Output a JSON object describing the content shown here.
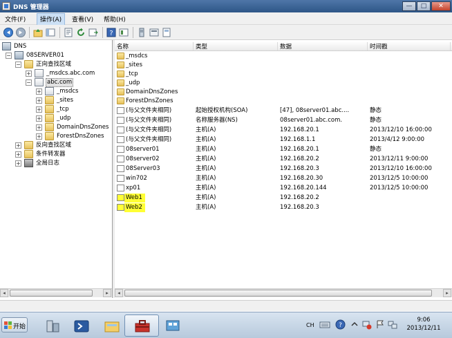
{
  "window": {
    "title": "DNS 管理器",
    "buttons": {
      "minimize": "—",
      "maximize": "□",
      "close": "✕"
    }
  },
  "menu": {
    "items": [
      {
        "label": "文件(F)"
      },
      {
        "label": "操作(A)"
      },
      {
        "label": "查看(V)"
      },
      {
        "label": "帮助(H)"
      }
    ]
  },
  "tree": {
    "root": {
      "label": "DNS"
    },
    "server": {
      "label": "08SERVER01"
    },
    "forward": {
      "label": "正向查找区域"
    },
    "msdcs_zone": {
      "label": "_msdcs.abc.com"
    },
    "abc_zone": {
      "label": "abc.com"
    },
    "children": [
      {
        "label": "_msdcs"
      },
      {
        "label": "_sites"
      },
      {
        "label": "_tcp"
      },
      {
        "label": "_udp"
      },
      {
        "label": "DomainDnsZones"
      },
      {
        "label": "ForestDnsZones"
      }
    ],
    "reverse": {
      "label": "反向查找区域"
    },
    "forwarders": {
      "label": "条件转发器"
    },
    "logs": {
      "label": "全局日志"
    }
  },
  "list": {
    "columns": {
      "name": "名称",
      "type": "类型",
      "data": "数据",
      "timestamp": "时间戳"
    },
    "folders": [
      {
        "name": "_msdcs"
      },
      {
        "name": "_sites"
      },
      {
        "name": "_tcp"
      },
      {
        "name": "_udp"
      },
      {
        "name": "DomainDnsZones"
      },
      {
        "name": "ForestDnsZones"
      }
    ],
    "records": [
      {
        "name": "(与父文件夹相同)",
        "type": "起始授权机构(SOA)",
        "data": "[47], 08server01.abc....",
        "timestamp": "静态",
        "highlight": false
      },
      {
        "name": "(与父文件夹相同)",
        "type": "名称服务器(NS)",
        "data": "08server01.abc.com.",
        "timestamp": "静态",
        "highlight": false
      },
      {
        "name": "(与父文件夹相同)",
        "type": "主机(A)",
        "data": "192.168.20.1",
        "timestamp": "2013/12/10 16:00:00",
        "highlight": false
      },
      {
        "name": "(与父文件夹相同)",
        "type": "主机(A)",
        "data": "192.168.1.1",
        "timestamp": "2013/4/12 9:00:00",
        "highlight": false
      },
      {
        "name": "08server01",
        "type": "主机(A)",
        "data": "192.168.20.1",
        "timestamp": "静态",
        "highlight": false
      },
      {
        "name": "08server02",
        "type": "主机(A)",
        "data": "192.168.20.2",
        "timestamp": "2013/12/11 9:00:00",
        "highlight": false
      },
      {
        "name": "08Server03",
        "type": "主机(A)",
        "data": "192.168.20.3",
        "timestamp": "2013/12/10 16:00:00",
        "highlight": false
      },
      {
        "name": "win702",
        "type": "主机(A)",
        "data": "192.168.20.30",
        "timestamp": "2013/12/5 10:00:00",
        "highlight": false
      },
      {
        "name": "xp01",
        "type": "主机(A)",
        "data": "192.168.20.144",
        "timestamp": "2013/12/5 10:00:00",
        "highlight": false
      },
      {
        "name": "Web1",
        "type": "主机(A)",
        "data": "192.168.20.2",
        "timestamp": "",
        "highlight": true
      },
      {
        "name": "Web2",
        "type": "主机(A)",
        "data": "192.168.20.3",
        "timestamp": "",
        "highlight": true
      }
    ]
  },
  "taskbar": {
    "start_label": "开始",
    "language": "CH",
    "clock_time": "9:06",
    "clock_date": "2013/12/11"
  },
  "colors": {
    "highlight": "#ffff35",
    "titlebar": "#2d5687"
  }
}
